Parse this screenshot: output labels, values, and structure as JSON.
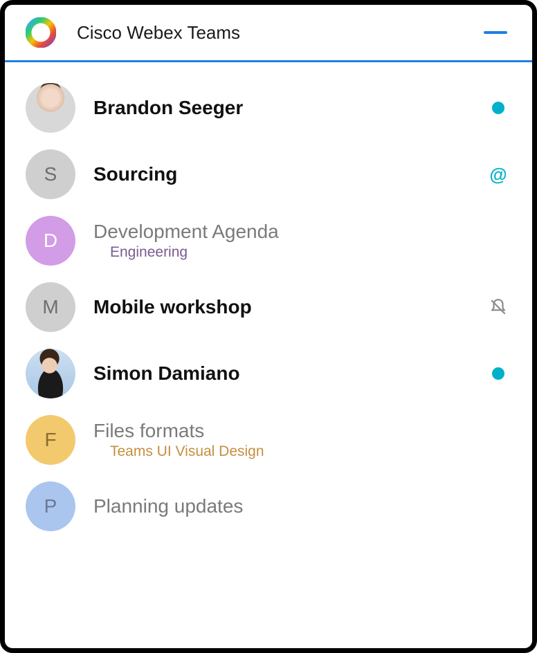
{
  "header": {
    "title": "Cisco Webex Teams"
  },
  "items": [
    {
      "avatar_type": "photo",
      "photo_variant": "photo1",
      "initial": "",
      "title": "Brandon Seeger",
      "bold": true,
      "subtitle": "",
      "subtitle_class": "",
      "indicator": "dot"
    },
    {
      "avatar_type": "letter",
      "avatar_class": "avatar-letter",
      "initial": "S",
      "title": "Sourcing",
      "bold": true,
      "subtitle": "",
      "subtitle_class": "",
      "indicator": "mention"
    },
    {
      "avatar_type": "letter",
      "avatar_class": "avatar-purple",
      "initial": "D",
      "title": "Development Agenda",
      "bold": false,
      "subtitle": "Engineering",
      "subtitle_class": "sub-eng",
      "indicator": ""
    },
    {
      "avatar_type": "letter",
      "avatar_class": "avatar-letter",
      "initial": "M",
      "title": "Mobile workshop",
      "bold": true,
      "subtitle": "",
      "subtitle_class": "",
      "indicator": "mute"
    },
    {
      "avatar_type": "photo",
      "photo_variant": "photo2",
      "initial": "",
      "title": "Simon Damiano",
      "bold": true,
      "subtitle": "",
      "subtitle_class": "",
      "indicator": "dot"
    },
    {
      "avatar_type": "letter",
      "avatar_class": "avatar-peach",
      "initial": "F",
      "title": "Files formats",
      "bold": false,
      "subtitle": "Teams UI Visual Design",
      "subtitle_class": "sub-design",
      "indicator": ""
    },
    {
      "avatar_type": "letter",
      "avatar_class": "avatar-blue",
      "initial": "P",
      "title": "Planning updates",
      "bold": false,
      "subtitle": "",
      "subtitle_class": "",
      "indicator": ""
    }
  ],
  "icons": {
    "mention_symbol": "@"
  }
}
